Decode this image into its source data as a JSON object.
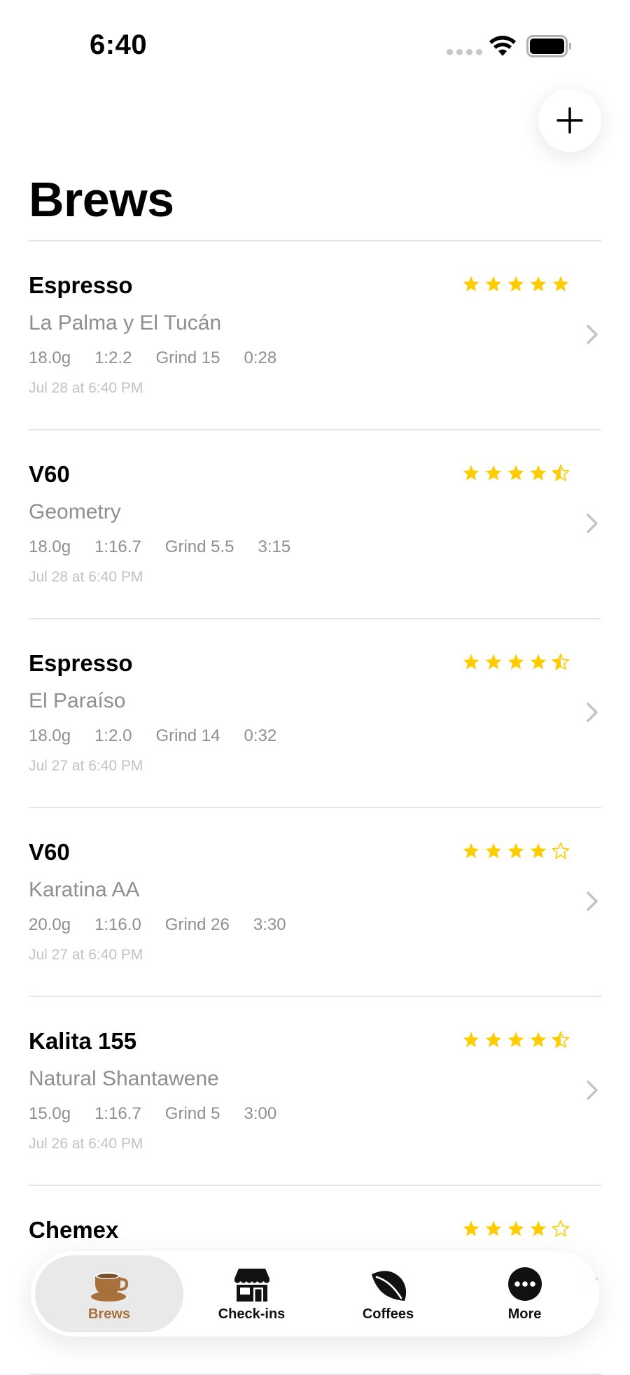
{
  "status_bar": {
    "time": "6:40"
  },
  "header": {
    "title": "Brews",
    "add_icon": "plus-icon"
  },
  "brews": [
    {
      "method": "Espresso",
      "coffee": "La Palma y El Tucán",
      "dose": "18.0g",
      "ratio": "1:2.2",
      "grind": "Grind 15",
      "time": "0:28",
      "date": "Jul 28 at 6:40 PM",
      "rating": 5
    },
    {
      "method": "V60",
      "coffee": "Geometry",
      "dose": "18.0g",
      "ratio": "1:16.7",
      "grind": "Grind 5.5",
      "time": "3:15",
      "date": "Jul 28 at 6:40 PM",
      "rating": 4.5
    },
    {
      "method": "Espresso",
      "coffee": "El Paraíso",
      "dose": "18.0g",
      "ratio": "1:2.0",
      "grind": "Grind 14",
      "time": "0:32",
      "date": "Jul 27 at 6:40 PM",
      "rating": 4.5
    },
    {
      "method": "V60",
      "coffee": "Karatina AA",
      "dose": "20.0g",
      "ratio": "1:16.0",
      "grind": "Grind 26",
      "time": "3:30",
      "date": "Jul 27 at 6:40 PM",
      "rating": 4
    },
    {
      "method": "Kalita 155",
      "coffee": "Natural Shantawene",
      "dose": "15.0g",
      "ratio": "1:16.7",
      "grind": "Grind 5",
      "time": "3:00",
      "date": "Jul 26 at 6:40 PM",
      "rating": 4.5
    },
    {
      "method": "Chemex",
      "coffee": "",
      "dose": "",
      "ratio": "",
      "grind": "",
      "time": "",
      "date": "",
      "rating": 4
    }
  ],
  "tab_bar": {
    "tabs": [
      {
        "label": "Brews",
        "icon": "coffee-cup-icon",
        "active": true
      },
      {
        "label": "Check-ins",
        "icon": "storefront-icon",
        "active": false
      },
      {
        "label": "Coffees",
        "icon": "leaf-icon",
        "active": false
      },
      {
        "label": "More",
        "icon": "ellipsis-circle-icon",
        "active": false
      }
    ]
  },
  "colors": {
    "star": "#FFCC00",
    "accent": "#A8713C",
    "secondary_text": "#8E8E93",
    "tertiary_text": "#C2C2C6",
    "divider": "#E5E5E5"
  }
}
